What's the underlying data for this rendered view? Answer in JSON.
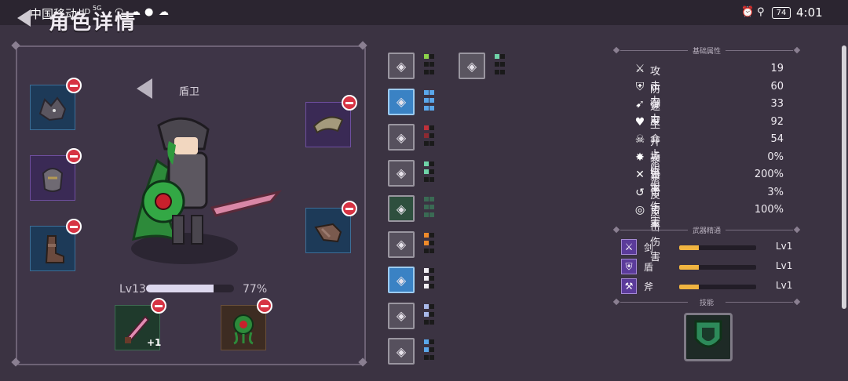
{
  "status_bar": {
    "carrier": "中国移动",
    "hd": "HD",
    "network": "5G",
    "battery": "74",
    "time": "4:01"
  },
  "header": {
    "title": "角色详情"
  },
  "character": {
    "name": "盾卫",
    "level": "Lv13",
    "xp_percent_text": "77%",
    "xp_fraction": 0.77,
    "weapon_plus": "+1"
  },
  "abilities": [
    {
      "icon": "fist-icon",
      "pips": [
        [
          "#8bd24a",
          "#1a1a1a"
        ],
        [
          "#1a1a1a",
          "#1a1a1a"
        ],
        [
          "#1a1a1a",
          "#1a1a1a"
        ]
      ]
    },
    {
      "icon": "shield-burst-icon",
      "pips": [
        [
          "#5aa7ea",
          "#5aa7ea"
        ],
        [
          "#5aa7ea",
          "#5aa7ea"
        ],
        [
          "#5aa7ea",
          "#5aa7ea"
        ]
      ]
    },
    {
      "icon": "orb-icon",
      "pips": [
        [
          "#c1303a",
          "#1a1a1a"
        ],
        [
          "#8c2a32",
          "#1a1a1a"
        ],
        [
          "#1a1a1a",
          "#1a1a1a"
        ]
      ]
    },
    {
      "icon": "eye-icon",
      "pips": [
        [
          "#6fd3a8",
          "#1a1a1a"
        ],
        [
          "#6fd3a8",
          "#1a1a1a"
        ],
        [
          "#1a1a1a",
          "#1a1a1a"
        ]
      ]
    },
    {
      "icon": "axe-icon",
      "pips": [
        [
          "#3a6a54",
          "#3a6a54"
        ],
        [
          "#3a6a54",
          "#3a6a54"
        ],
        [
          "#3a6a54",
          "#3a6a54"
        ]
      ]
    },
    {
      "icon": "wing-icon",
      "pips": [
        [
          "#ef8a2a",
          "#1a1a1a"
        ],
        [
          "#ef8a2a",
          "#1a1a1a"
        ],
        [
          "#1a1a1a",
          "#1a1a1a"
        ]
      ]
    },
    {
      "icon": "helmet-icon",
      "pips": [
        [
          "#f1eef4",
          "#1a1a1a"
        ],
        [
          "#f1eef4",
          "#1a1a1a"
        ],
        [
          "#f1eef4",
          "#1a1a1a"
        ]
      ]
    },
    {
      "icon": "compass-icon",
      "pips": [
        [
          "#a9b9ea",
          "#1a1a1a"
        ],
        [
          "#a9b9ea",
          "#1a1a1a"
        ],
        [
          "#1a1a1a",
          "#1a1a1a"
        ]
      ]
    },
    {
      "icon": "runner-icon",
      "pips": [
        [
          "#5aa7ea",
          "#1a1a1a"
        ],
        [
          "#5aa7ea",
          "#1a1a1a"
        ],
        [
          "#1a1a1a",
          "#1a1a1a"
        ]
      ]
    }
  ],
  "extra_ability": {
    "icon": "fist-dark-icon",
    "pips": [
      [
        "#6fd3a8",
        "#1a1a1a"
      ],
      [
        "#1a1a1a",
        "#1a1a1a"
      ],
      [
        "#1a1a1a",
        "#1a1a1a"
      ]
    ]
  },
  "stats": {
    "header": "基础属性",
    "items": [
      {
        "icon": "sword-icon",
        "glyph": "⚔",
        "label": "攻击力",
        "value": "19"
      },
      {
        "icon": "shield-icon",
        "glyph": "⛨",
        "label": "防御力",
        "value": "60"
      },
      {
        "icon": "boot-icon",
        "glyph": "➹",
        "label": "速度",
        "value": "33"
      },
      {
        "icon": "heart-icon",
        "glyph": "♥",
        "label": "生命上限",
        "value": "92"
      },
      {
        "icon": "skull-icon",
        "glyph": "☠",
        "label": "开场仇恨",
        "value": "54"
      },
      {
        "icon": "burst-icon",
        "glyph": "✸",
        "label": "暴击率",
        "value": "0%"
      },
      {
        "icon": "crossed-swords-icon",
        "glyph": "✕",
        "label": "暴击伤害",
        "value": "200%"
      },
      {
        "icon": "counter-icon",
        "glyph": "↺",
        "label": "反击率",
        "value": "3%"
      },
      {
        "icon": "swirl-icon",
        "glyph": "◎",
        "label": "反击伤害",
        "value": "100%"
      }
    ]
  },
  "mastery": {
    "header": "武器精通",
    "items": [
      {
        "icon": "sword-mastery-icon",
        "glyph": "⚔",
        "label": "剑",
        "level": "Lv1",
        "fraction": 0.25
      },
      {
        "icon": "shield-mastery-icon",
        "glyph": "⛨",
        "label": "盾",
        "level": "Lv1",
        "fraction": 0.25
      },
      {
        "icon": "axe-mastery-icon",
        "glyph": "⚒",
        "label": "斧",
        "level": "Lv1",
        "fraction": 0.25
      }
    ]
  },
  "skills": {
    "header": "技能"
  },
  "colors": {
    "accent_red": "#d63343",
    "mastery_fill": "#f0b440",
    "panel_bg": "#3e3547"
  }
}
